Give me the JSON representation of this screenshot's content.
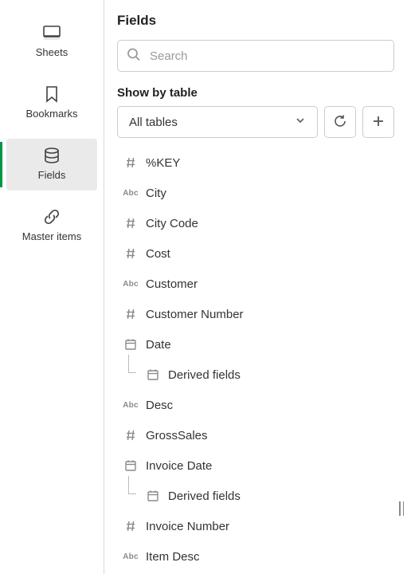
{
  "sidebar": {
    "items": [
      {
        "id": "sheets",
        "label": "Sheets"
      },
      {
        "id": "bookmarks",
        "label": "Bookmarks"
      },
      {
        "id": "fields",
        "label": "Fields"
      },
      {
        "id": "master-items",
        "label": "Master items"
      }
    ],
    "active": "fields"
  },
  "panel": {
    "title": "Fields",
    "search_placeholder": "Search",
    "show_by_label": "Show by table",
    "table_select_value": "All tables"
  },
  "fields": [
    {
      "type": "hash",
      "name": "%KEY"
    },
    {
      "type": "abc",
      "name": "City"
    },
    {
      "type": "hash",
      "name": "City Code"
    },
    {
      "type": "hash",
      "name": "Cost"
    },
    {
      "type": "abc",
      "name": "Customer"
    },
    {
      "type": "hash",
      "name": "Customer Number"
    },
    {
      "type": "date",
      "name": "Date"
    },
    {
      "type": "date",
      "name": "Derived fields",
      "child": true
    },
    {
      "type": "abc",
      "name": "Desc"
    },
    {
      "type": "hash",
      "name": "GrossSales"
    },
    {
      "type": "date",
      "name": "Invoice Date"
    },
    {
      "type": "date",
      "name": "Derived fields",
      "child": true
    },
    {
      "type": "hash",
      "name": "Invoice Number"
    },
    {
      "type": "abc",
      "name": "Item Desc"
    }
  ]
}
